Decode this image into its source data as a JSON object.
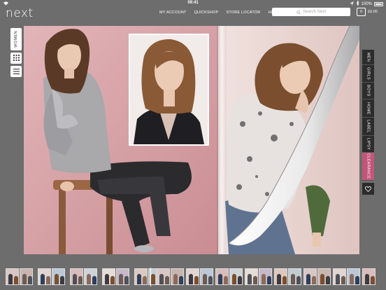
{
  "status": {
    "time": "09:41",
    "battery": "100%"
  },
  "header": {
    "logo": "next",
    "nav": [
      "MY ACCOUNT",
      "QUICKSHOP",
      "STORE LOCATOR",
      "HELP"
    ],
    "search_placeholder": "Search Next",
    "bag_count": "0",
    "bag_total": "£0.00"
  },
  "left_tabs": {
    "section": "WOMEN"
  },
  "right_tabs": [
    {
      "label": "MEN",
      "active": false
    },
    {
      "label": "GIRLS",
      "active": false
    },
    {
      "label": "BOYS",
      "active": false
    },
    {
      "label": "HOME",
      "active": false
    },
    {
      "label": "LABEL",
      "active": false
    },
    {
      "label": "LIPSY",
      "active": false
    },
    {
      "label": "CLEARANCE",
      "active": true
    }
  ],
  "colors": {
    "background": "#6d6d6d",
    "left_page": "#d9a8ac",
    "tab_dark": "#2c2c2c",
    "tab_active": "#c2567a"
  },
  "icons": {
    "left_grid": "grid-icon",
    "left_menu": "hamburger-icon",
    "wishlist": "heart-icon",
    "search": "search-icon"
  }
}
